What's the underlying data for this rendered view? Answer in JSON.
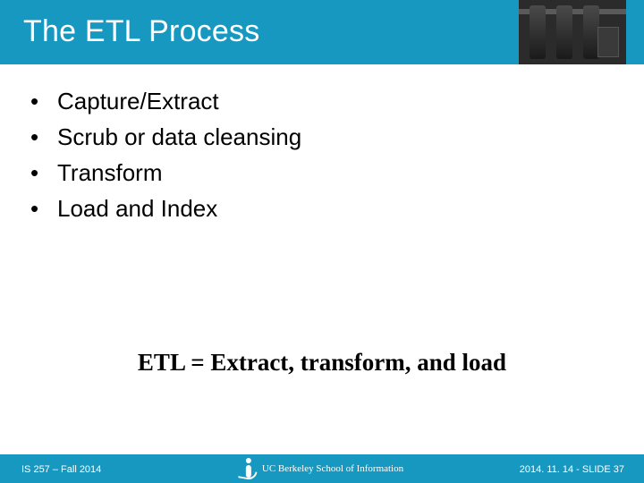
{
  "title": "The ETL Process",
  "bullets": [
    "Capture/Extract",
    "Scrub or data cleansing",
    "Transform",
    "Load and Index"
  ],
  "definition": "ETL = Extract, transform, and load",
  "footer": {
    "left": "IS 257 – Fall 2014",
    "center": "UC Berkeley School of Information",
    "right": "2014. 11. 14 -  SLIDE 37"
  }
}
